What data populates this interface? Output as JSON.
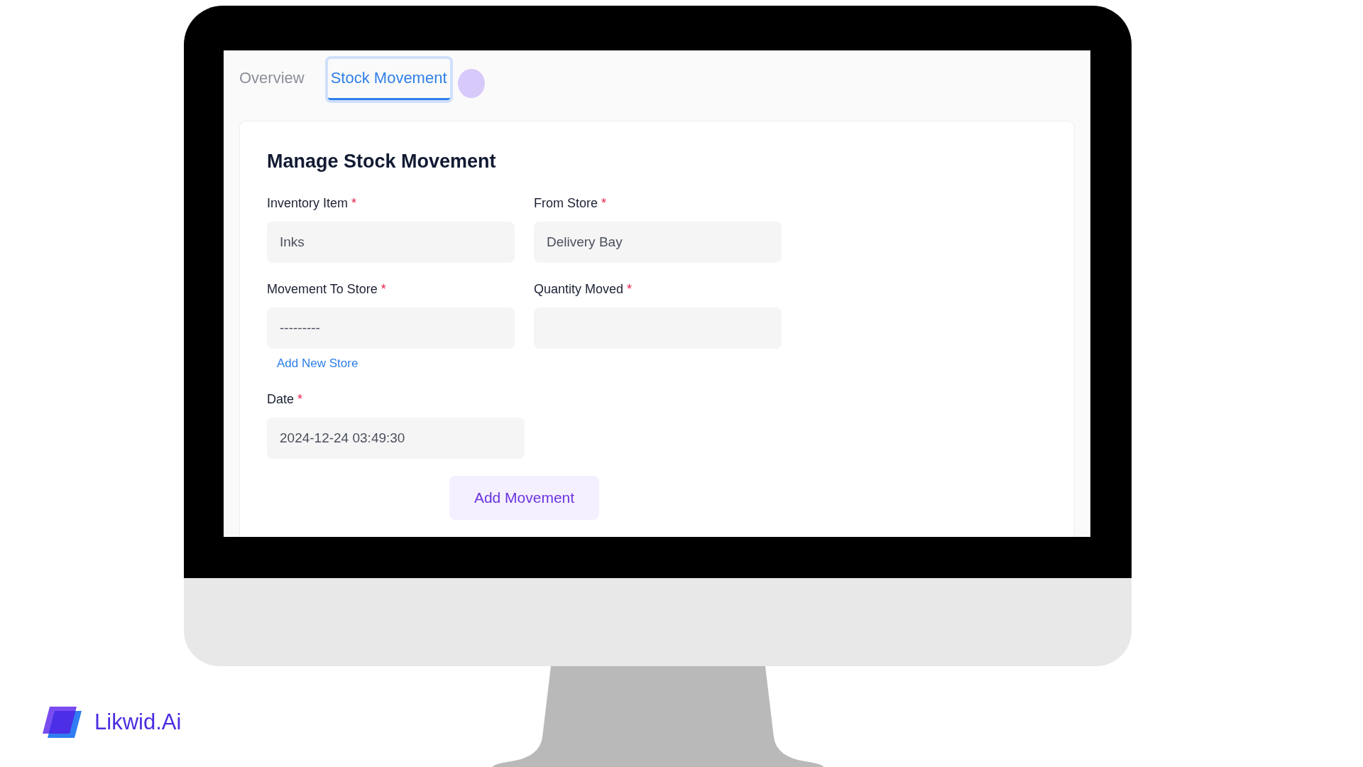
{
  "tabs": [
    {
      "label": "Overview",
      "selected": false
    },
    {
      "label": "Stock Movement",
      "selected": true
    }
  ],
  "form": {
    "title": "Manage Stock Movement",
    "rows": [
      [
        {
          "kind": "select",
          "label": "Inventory Item",
          "required_mark": "*",
          "value": "Inks"
        },
        {
          "kind": "select",
          "label": "From Store",
          "required_mark": "*",
          "value": "Delivery Bay"
        }
      ],
      [
        {
          "kind": "select",
          "label": "Movement To Store",
          "required_mark": "*",
          "value": "---------",
          "link": "Add New Store"
        },
        {
          "kind": "number",
          "label": "Quantity Moved",
          "required_mark": "*"
        }
      ],
      [
        {
          "kind": "datetime",
          "label": "Date",
          "required_mark": "*",
          "value": "2024-12-24 03:49:30"
        }
      ]
    ],
    "submit": "Add Movement"
  },
  "brand": {
    "name": "Likwid.Ai"
  }
}
